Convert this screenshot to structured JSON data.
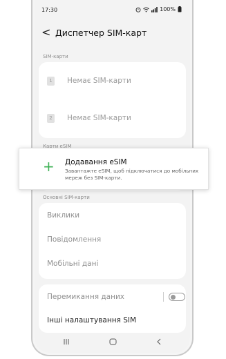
{
  "status_bar": {
    "time": "17:30",
    "battery": "100%"
  },
  "header": {
    "back_glyph": "<",
    "title": "Диспетчер SIM-карт"
  },
  "sim_section": {
    "label": "SIM-карти",
    "items": [
      {
        "number": "1",
        "label": "Немає SIM-карти"
      },
      {
        "number": "2",
        "label": "Немає SIM-карти"
      }
    ]
  },
  "esim_section": {
    "label": "Карти eSIM"
  },
  "add_esim": {
    "title": "Додавання eSIM",
    "description": "Завантажте eSIM, щоб підключатися до мобільних мереж без SIM-карти."
  },
  "primary_section": {
    "label": "Основні SIM-карти",
    "items": [
      "Виклики",
      "Повідомлення",
      "Мобільні дані"
    ]
  },
  "data_switching": {
    "label": "Перемикання даних",
    "enabled": false
  },
  "more_settings": {
    "label": "Інші налаштування SIM"
  },
  "colors": {
    "accent": "#3fb256",
    "background": "#f3f3f3"
  },
  "icons": [
    "back-icon",
    "sim-1-icon",
    "sim-2-icon",
    "plus-icon",
    "recents-icon",
    "home-icon",
    "back-nav-icon"
  ]
}
